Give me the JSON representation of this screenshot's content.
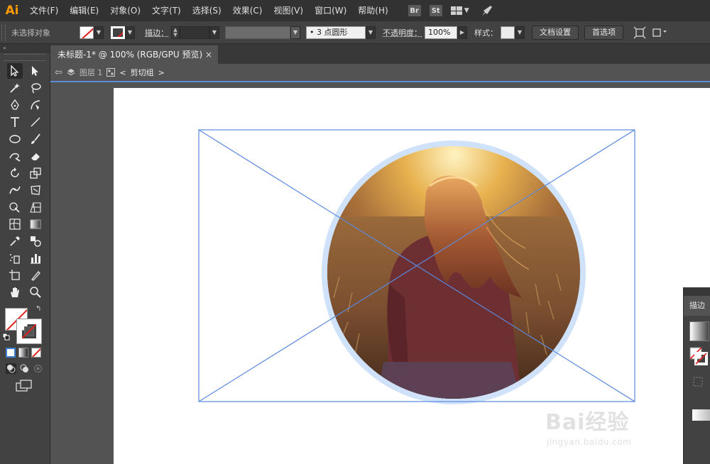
{
  "app": {
    "logo": "Ai"
  },
  "menu": {
    "items": [
      "文件(F)",
      "编辑(E)",
      "对象(O)",
      "文字(T)",
      "选择(S)",
      "效果(C)",
      "视图(V)",
      "窗口(W)",
      "帮助(H)"
    ],
    "bridge": "Br",
    "stock": "St"
  },
  "control": {
    "selection": "未选择对象",
    "stroke_label": "描边：",
    "stroke_weight": "",
    "brush": "3 点圆形",
    "opacity_label": "不透明度：",
    "opacity_value": "100%",
    "style_label": "样式：",
    "doc_setup": "文档设置",
    "preferences": "首选项"
  },
  "toolbar": {
    "collapse": "«"
  },
  "document": {
    "tab_title": "未标题-1* @ 100% (RGB/GPU 预览)",
    "close": "×"
  },
  "breadcrumb": {
    "layer": "图层 1",
    "group": "剪切组"
  },
  "right_panel": {
    "tab": "描边"
  },
  "watermark": {
    "brand": "Bai经验",
    "url": "jingyan.baidu.com"
  },
  "colors": {
    "selection": "#5b8ae0",
    "ring": "#cfe2fa",
    "accent": "#ff9a00"
  }
}
